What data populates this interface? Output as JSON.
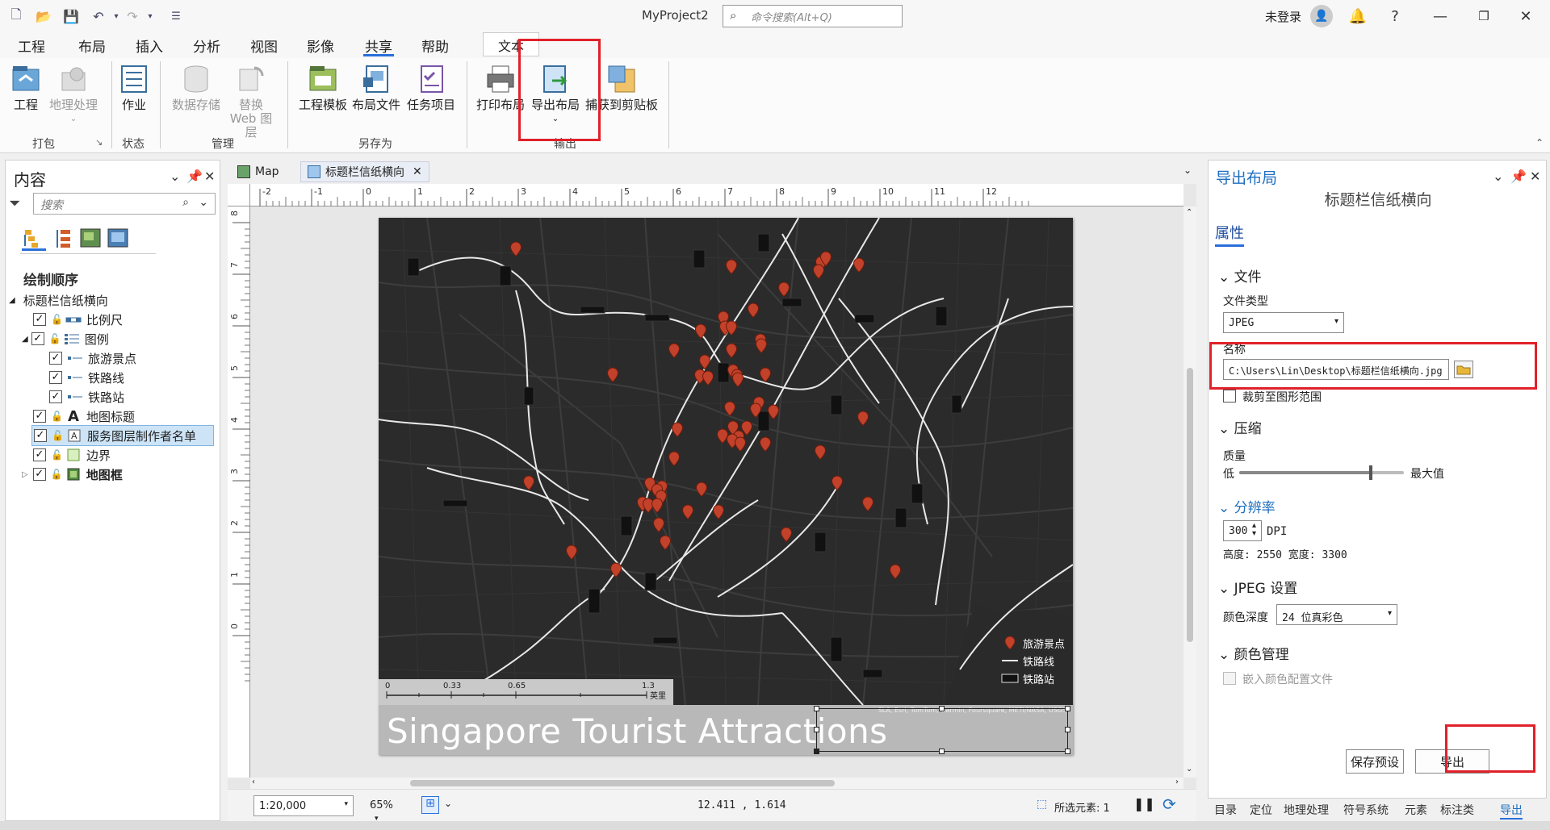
{
  "app": {
    "title": "MyProject2",
    "command_search_placeholder": "命令搜索(Alt+Q)",
    "login": "未登录"
  },
  "menu": {
    "tabs": [
      "工程",
      "布局",
      "插入",
      "分析",
      "视图",
      "影像",
      "共享",
      "帮助"
    ],
    "active": "共享",
    "context_tab": "文本"
  },
  "ribbon": {
    "buttons": {
      "project": "工程",
      "geoprocessing": "地理处理",
      "jobs": "作业",
      "data_store": "数据存储",
      "replace_web_layer": "替换 Web 图层",
      "project_template": "工程模板",
      "layout_file": "布局文件",
      "task_item": "任务项目",
      "print_layout": "打印布局",
      "export_layout": "导出布局",
      "capture_clipboard": "捕获到剪贴板"
    },
    "groups": [
      "打包",
      "状态",
      "管理",
      "另存为",
      "输出"
    ]
  },
  "contents": {
    "title": "内容",
    "search_placeholder": "搜索",
    "draw_order": "绘制顺序",
    "layout_name": "标题栏信纸横向",
    "items": [
      {
        "label": "比例尺",
        "checked": true,
        "level": 1
      },
      {
        "label": "图例",
        "checked": true,
        "level": 1,
        "expanded": true
      },
      {
        "label": "旅游景点",
        "checked": true,
        "level": 2
      },
      {
        "label": "铁路线",
        "checked": true,
        "level": 2
      },
      {
        "label": "铁路站",
        "checked": true,
        "level": 2
      },
      {
        "label": "地图标题",
        "checked": true,
        "level": 1
      },
      {
        "label": "服务图层制作者名单",
        "checked": true,
        "level": 1,
        "selected": true
      },
      {
        "label": "边界",
        "checked": true,
        "level": 1
      },
      {
        "label": "地图框",
        "checked": true,
        "level": 1,
        "bold": true
      }
    ]
  },
  "view_tabs": [
    {
      "label": "Map",
      "active": false
    },
    {
      "label": "标题栏信纸横向",
      "active": true
    }
  ],
  "rulers": {
    "top": [
      "-2",
      "-1",
      "0",
      "1",
      "2",
      "3",
      "4",
      "5",
      "6",
      "7",
      "8",
      "9",
      "10",
      "11",
      "12"
    ],
    "left": [
      "8",
      "7",
      "6",
      "5",
      "4",
      "3",
      "2",
      "1",
      "0"
    ]
  },
  "map": {
    "title": "Singapore Tourist Attractions",
    "credits": "SLA, Esri, TomTom, Garmin, Foursquare, METI/NASA, USGS",
    "scalebar": {
      "ticks": [
        "0",
        "0.33",
        "0.65",
        "1.3"
      ],
      "unit": "英里"
    },
    "legend": [
      "旅游景点",
      "铁路线",
      "铁路站"
    ],
    "colors": {
      "background": "#2b2b2b",
      "road": "#3f3f3f",
      "rail": "#e6e6e6",
      "poi": "#c2412a"
    }
  },
  "statusbar": {
    "scale": "1:20,000",
    "zoom": "65%",
    "coords": "12.411 , 1.614",
    "selected": "所选元素: 1"
  },
  "export": {
    "title": "导出布局",
    "layout_name": "标题栏信纸横向",
    "properties_tab": "属性",
    "file_section": "文件",
    "file_type_label": "文件类型",
    "file_type": "JPEG",
    "name_label": "名称",
    "name_value": "C:\\Users\\Lin\\Desktop\\标题栏信纸横向.jpg",
    "clip_label": "裁剪至图形范围",
    "compression_section": "压缩",
    "quality_label": "质量",
    "quality_low": "低",
    "quality_high": "最大值",
    "quality_level": 0.8,
    "resolution_section": "分辨率",
    "dpi": "300",
    "dpi_unit": "DPI",
    "size_text": "高度: 2550 宽度: 3300",
    "jpeg_section": "JPEG 设置",
    "color_depth_label": "颜色深度",
    "color_depth": "24 位真彩色",
    "color_mgmt_section": "颜色管理",
    "embed_profile": "嵌入颜色配置文件",
    "save_preset": "保存预设",
    "export_button": "导出"
  },
  "bottom_tabs": [
    "目录",
    "定位",
    "地理处理",
    "符号系统",
    "元素",
    "标注类",
    "导出"
  ]
}
